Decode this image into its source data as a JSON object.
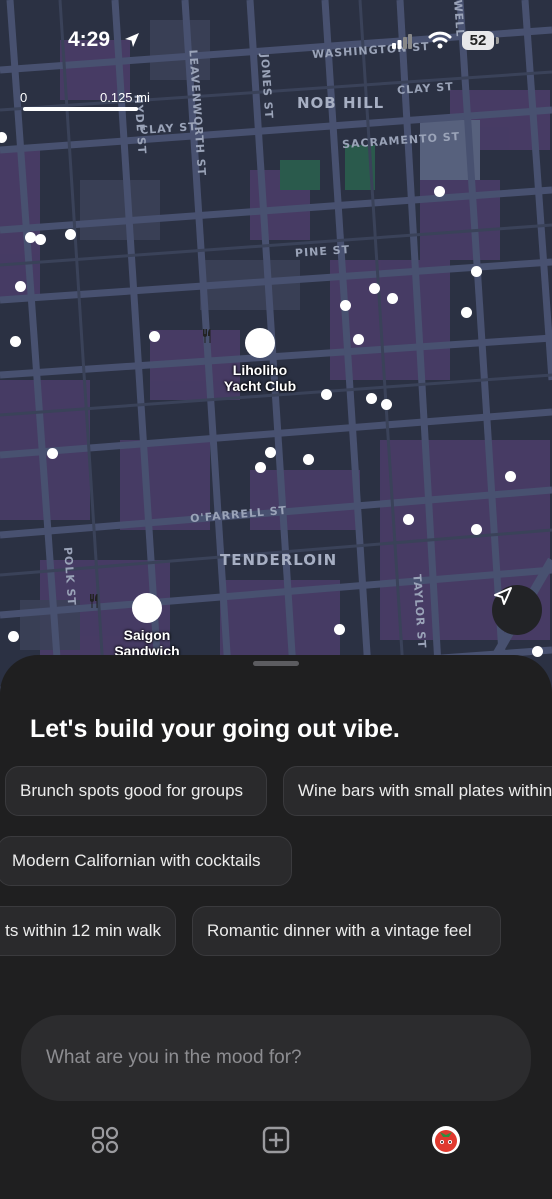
{
  "status_bar": {
    "time": "4:29",
    "battery": "52"
  },
  "map": {
    "scale": {
      "start": "0",
      "end": "0.125 mi"
    },
    "streets": [
      "WASHINGTON ST",
      "CLAY ST",
      "CLAY ST",
      "SACRAMENTO ST",
      "PINE ST",
      "O'FARRELL ST",
      "LEAVENWORTH ST",
      "JONES ST",
      "POLK ST",
      "TAYLOR ST",
      "HYDE ST",
      "WELL"
    ],
    "areas": [
      "NOB HILL",
      "TENDERLOIN"
    ],
    "pois": [
      {
        "name_line1": "Liholiho",
        "name_line2": "Yacht Club",
        "icon": "fork-knife-icon"
      },
      {
        "name_line1": "Saigon",
        "name_line2": "Sandwich",
        "icon": "fork-knife-icon"
      }
    ]
  },
  "sheet": {
    "headline": "Let's build your going out vibe.",
    "chips_row1": [
      "Brunch spots good for groups",
      "Wine bars with small plates within"
    ],
    "chips_row2": [
      "Modern Californian with cocktails"
    ],
    "chips_row3": [
      "ts within 12 min walk",
      "Romantic dinner with a vintage feel"
    ],
    "input_placeholder": "What are you in the mood for?"
  },
  "colors": {
    "map_bg": "#1b2030",
    "map_street": "#3e4760",
    "map_block_purple": "#4b3d6b",
    "sheet_bg": "#1f1f20",
    "chip_bg": "#2a2a2c"
  },
  "nav": [
    "grid-icon",
    "plus-square-icon",
    "tomato-avatar-icon"
  ]
}
